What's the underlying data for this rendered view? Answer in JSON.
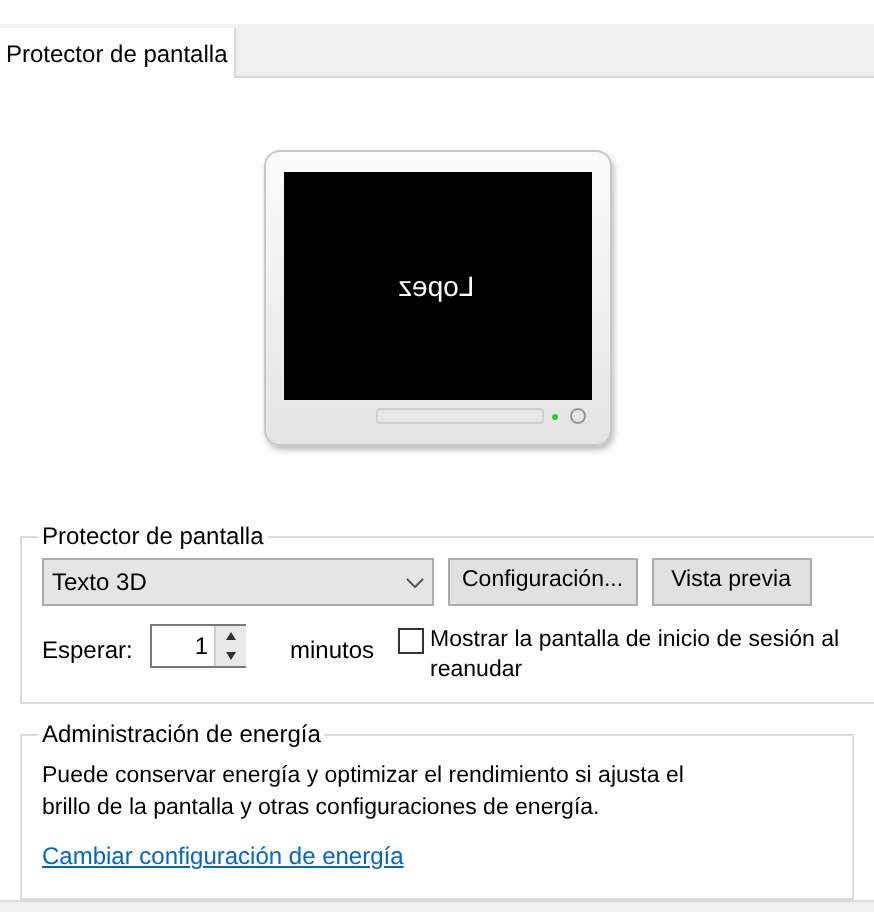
{
  "tabs": [
    {
      "label": "Protector de pantalla",
      "selected": true
    }
  ],
  "preview": {
    "text": "Lopez"
  },
  "screensaver_group": {
    "title": "Protector de pantalla",
    "dropdown": {
      "value": "Texto 3D"
    },
    "buttons": [
      "Configuración...",
      "Vista previa"
    ],
    "wait_label": "Esperar:",
    "wait_value": "1",
    "unit": "minutos",
    "checkbox": {
      "label": "Mostrar la pantalla de inicio de sesión al reanudar",
      "checked": false
    }
  },
  "power_group": {
    "title": "Administración de energía",
    "description": "Puede conservar energía y optimizar el rendimiento si ajusta el brillo de la pantalla y otras configuraciones de energía.",
    "link": "Cambiar configuración de energía"
  }
}
